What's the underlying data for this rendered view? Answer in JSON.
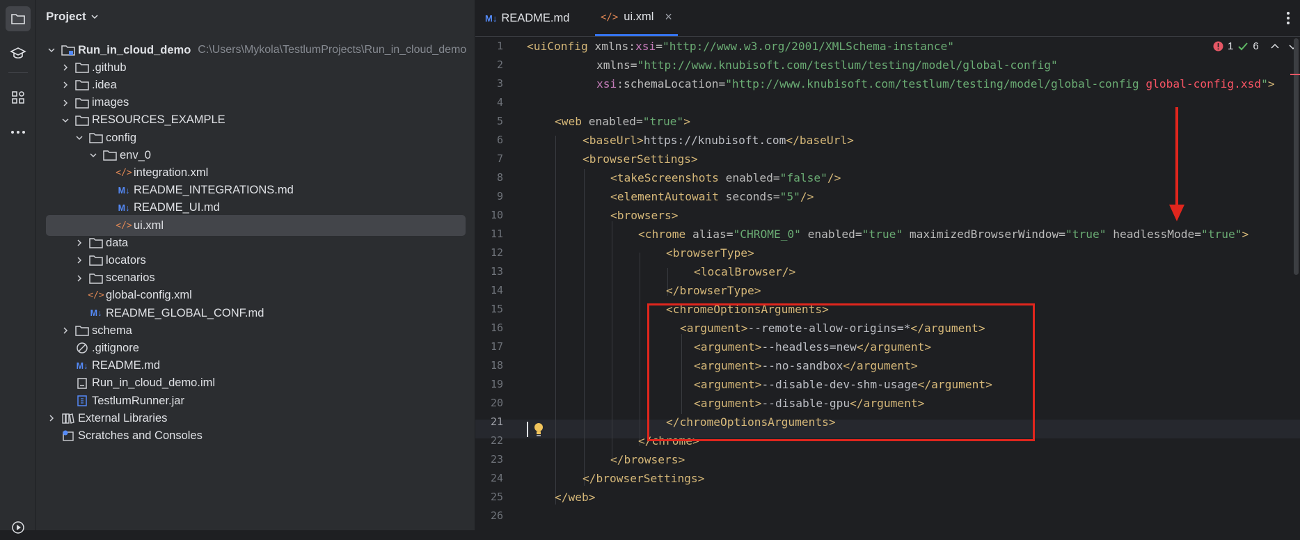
{
  "project_panel": {
    "title": "Project",
    "tree": [
      {
        "label": "Run_in_cloud_demo",
        "path": "C:\\Users\\Mykola\\TestlumProjects\\Run_in_cloud_demo",
        "icon": "module-folder-icon"
      },
      {
        "label": ".github",
        "icon": "folder-icon"
      },
      {
        "label": ".idea",
        "icon": "folder-icon"
      },
      {
        "label": "images",
        "icon": "folder-icon"
      },
      {
        "label": "RESOURCES_EXAMPLE",
        "icon": "folder-icon"
      },
      {
        "label": "config",
        "icon": "folder-icon"
      },
      {
        "label": "env_0",
        "icon": "folder-icon"
      },
      {
        "label": "integration.xml",
        "icon": "xml-file-icon"
      },
      {
        "label": "README_INTEGRATIONS.md",
        "icon": "markdown-file-icon"
      },
      {
        "label": "README_UI.md",
        "icon": "markdown-file-icon"
      },
      {
        "label": "ui.xml",
        "icon": "xml-file-icon"
      },
      {
        "label": "data",
        "icon": "folder-icon"
      },
      {
        "label": "locators",
        "icon": "folder-icon"
      },
      {
        "label": "scenarios",
        "icon": "folder-icon"
      },
      {
        "label": "global-config.xml",
        "icon": "xml-file-icon"
      },
      {
        "label": "README_GLOBAL_CONF.md",
        "icon": "markdown-file-icon"
      },
      {
        "label": "schema",
        "icon": "folder-icon"
      },
      {
        "label": ".gitignore",
        "icon": "ignore-file-icon"
      },
      {
        "label": "README.md",
        "icon": "markdown-file-icon"
      },
      {
        "label": "Run_in_cloud_demo.iml",
        "icon": "iml-file-icon"
      },
      {
        "label": "TestlumRunner.jar",
        "icon": "jar-file-icon"
      },
      {
        "label": "External Libraries",
        "icon": "libraries-icon"
      },
      {
        "label": "Scratches and Consoles",
        "icon": "scratches-icon"
      }
    ]
  },
  "tabs": [
    {
      "label": "README.md",
      "icon": "markdown-file-icon"
    },
    {
      "label": "ui.xml",
      "icon": "xml-file-icon",
      "close": "×"
    }
  ],
  "inspections": {
    "errors": "1",
    "ok": "6"
  },
  "line_numbers": [
    "1",
    "2",
    "3",
    "4",
    "5",
    "6",
    "7",
    "8",
    "9",
    "10",
    "11",
    "12",
    "13",
    "14",
    "15",
    "16",
    "17",
    "18",
    "19",
    "20",
    "21",
    "22",
    "23",
    "24",
    "25",
    "26"
  ],
  "code": {
    "l1": {
      "t1": "<uiConfig",
      "a1": " xmlns",
      "p1": ":",
      "n1": "xsi",
      "e1": "=",
      "v1": "\"http://www.w3.org/2001/XMLSchema-instance\""
    },
    "l2": {
      "a1": "xmlns",
      "e1": "=",
      "v1": "\"http://www.knubisoft.com/testlum/testing/model/global-config\""
    },
    "l3": {
      "n1": "xsi",
      "a1": ":schemaLocation",
      "e1": "=",
      "v1": "\"http://www.knubisoft.com/testlum/testing/model/global-config ",
      "r1": "global-config.xsd",
      "v2": "\"",
      "t1": ">"
    },
    "l5": {
      "t1": "<web",
      "a1": " enabled",
      "e1": "=",
      "v1": "\"true\"",
      "t2": ">"
    },
    "l6": {
      "t1": "<baseUrl>",
      "x1": "https://knubisoft.com",
      "t2": "</baseUrl>"
    },
    "l7": {
      "t1": "<browserSettings>"
    },
    "l8": {
      "t1": "<takeScreenshots",
      "a1": " enabled",
      "e1": "=",
      "v1": "\"false\"",
      "t2": "/>"
    },
    "l9": {
      "t1": "<elementAutowait",
      "a1": " seconds",
      "e1": "=",
      "v1": "\"5\"",
      "t2": "/>"
    },
    "l10": {
      "t1": "<browsers>"
    },
    "l11": {
      "t1": "<chrome",
      "a1": " alias",
      "e1": "=",
      "v1": "\"CHROME_0\"",
      "a2": " enabled",
      "e2": "=",
      "v2": "\"true\"",
      "a3": " maximizedBrowserWindow",
      "e3": "=",
      "v3": "\"true\"",
      "a4": " headlessMode",
      "e4": "=",
      "v4": "\"true\"",
      "t2": ">"
    },
    "l12": {
      "t1": "<browserType>"
    },
    "l13": {
      "t1": "<localBrowser/>"
    },
    "l14": {
      "t1": "</browserType>"
    },
    "l15": {
      "t1": "<chromeOptionsArguments>"
    },
    "l16": {
      "t1": "<argument>",
      "x1": "--remote-allow-origins=*",
      "t2": "</argument>"
    },
    "l17": {
      "t1": "<argument>",
      "x1": "--headless=new",
      "t2": "</argument>"
    },
    "l18": {
      "t1": "<argument>",
      "x1": "--no-sandbox",
      "t2": "</argument>"
    },
    "l19": {
      "t1": "<argument>",
      "x1": "--disable-dev-shm-usage",
      "t2": "</argument>"
    },
    "l20": {
      "t1": "<argument>",
      "x1": "--disable-gpu",
      "t2": "</argument>"
    },
    "l21": {
      "t1": "</chromeOptionsArguments>"
    },
    "l22": {
      "t1": "</chrome>"
    },
    "l23": {
      "t1": "</browsers>"
    },
    "l24": {
      "t1": "</browserSettings>"
    },
    "l25": {
      "t1": "</web>"
    }
  },
  "colors": {
    "annotation": "#e0261d",
    "accent": "#3574f0",
    "tag": "#d5b778",
    "value": "#6aab73",
    "namespace": "#c77dbb"
  }
}
